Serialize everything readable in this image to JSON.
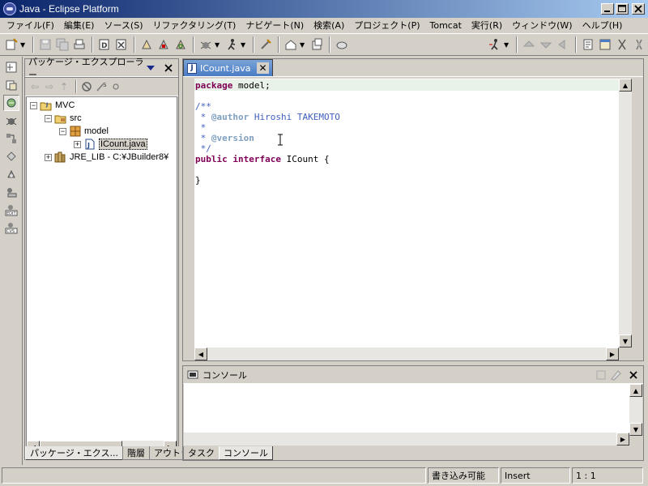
{
  "window": {
    "title": "Java - Eclipse Platform"
  },
  "menu": [
    "ファイル(F)",
    "編集(E)",
    "ソース(S)",
    "リファクタリング(T)",
    "ナビゲート(N)",
    "検索(A)",
    "プロジェクト(P)",
    "Tomcat",
    "実行(R)",
    "ウィンドウ(W)",
    "ヘルプ(H)"
  ],
  "package_explorer": {
    "title": "パッケージ・エクスプローラー",
    "tree": [
      {
        "label": "MVC",
        "icon": "project-icon",
        "exp": "−",
        "level": 0
      },
      {
        "label": "src",
        "icon": "source-folder-icon",
        "exp": "−",
        "level": 1
      },
      {
        "label": "model",
        "icon": "package-icon",
        "exp": "−",
        "level": 2
      },
      {
        "label": "ICount.java",
        "icon": "java-file-icon",
        "exp": "+",
        "level": 3,
        "selected": true
      },
      {
        "label": "JRE_LIB - C:¥JBuilder8¥",
        "icon": "library-icon",
        "exp": "+",
        "level": 1
      }
    ],
    "bottom_tabs": [
      "パッケージ・エクス...",
      "階層",
      "アウトライン"
    ]
  },
  "editor": {
    "tab_label": "ICount.java",
    "code": {
      "line1_kw": "package",
      "line1_rest": " model;",
      "line2": "/**",
      "line3_star": " * ",
      "line3_tag": "@author",
      "line3_rest": " Hiroshi TAKEMOTO",
      "line4": " *",
      "line5_star": " * ",
      "line5_tag": "@version",
      "line6": " */",
      "line7_kw1": "public",
      "line7_kw2": "interface",
      "line7_rest": " ICount {",
      "line9": "}"
    }
  },
  "console": {
    "title": "コンソール",
    "bottom_tabs": [
      "タスク",
      "コンソール"
    ]
  },
  "status": {
    "writable": "書き込み可能",
    "insert_mode": "Insert",
    "position": "1 : 1"
  }
}
